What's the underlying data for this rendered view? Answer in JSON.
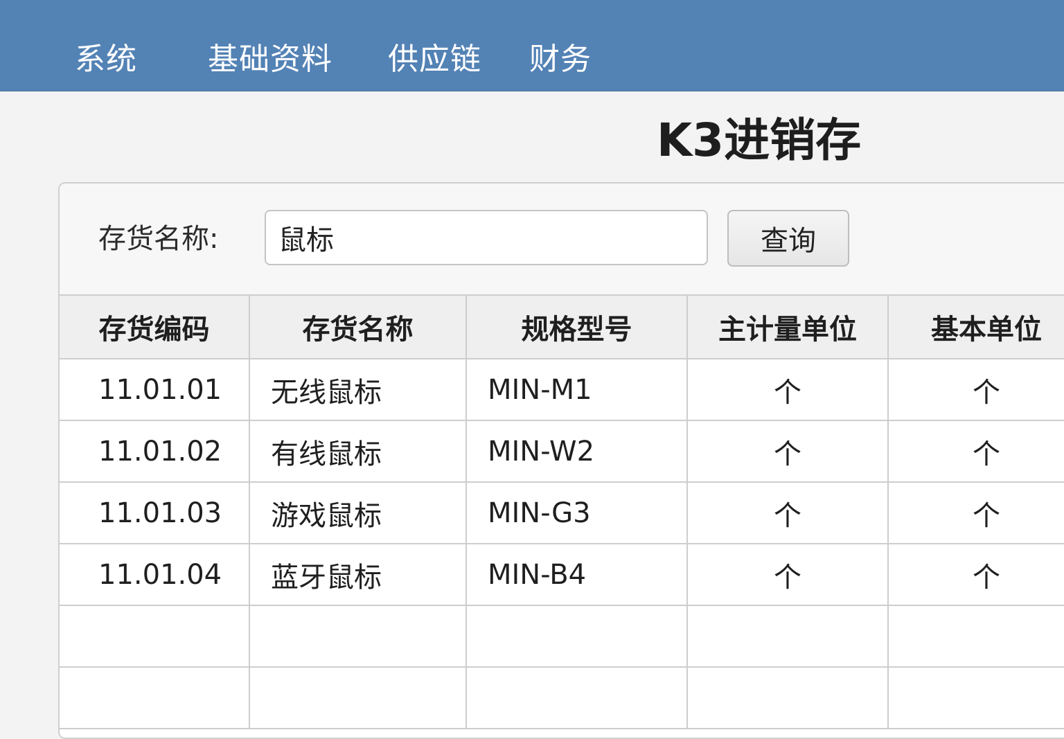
{
  "menu": {
    "items": [
      {
        "label": "系统"
      },
      {
        "label": "基础资料"
      },
      {
        "label": "供应链"
      },
      {
        "label": "财务"
      }
    ]
  },
  "app_title": "K3进销存",
  "search": {
    "label": "存货名称:",
    "value": "鼠标",
    "button_label": "查询"
  },
  "table": {
    "columns": [
      "存货编码",
      "存货名称",
      "规格型号",
      "主计量单位",
      "基本单位"
    ],
    "rows": [
      {
        "code": "11.01.01",
        "name": "无线鼠标",
        "spec": "MIN-M1",
        "main_unit": "个",
        "base_unit": "个"
      },
      {
        "code": "11.01.02",
        "name": "有线鼠标",
        "spec": "MIN-W2",
        "main_unit": "个",
        "base_unit": "个"
      },
      {
        "code": "11.01.03",
        "name": "游戏鼠标",
        "spec": "MIN-G3",
        "main_unit": "个",
        "base_unit": "个"
      },
      {
        "code": "11.01.04",
        "name": "蓝牙鼠标",
        "spec": "MIN-B4",
        "main_unit": "个",
        "base_unit": "个"
      }
    ]
  },
  "colors": {
    "menubar": "#5382b5",
    "background": "#f3f3f3",
    "header_row": "#efefef"
  }
}
